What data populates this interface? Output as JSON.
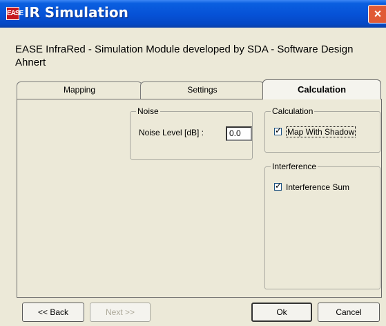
{
  "window": {
    "icon_text": "EASE",
    "title": "IR Simulation",
    "close_glyph": "×"
  },
  "description": "EASE InfraRed - Simulation Module developed by SDA - Software Design Ahnert",
  "tabs": [
    {
      "label": "Mapping",
      "selected": false
    },
    {
      "label": "Settings",
      "selected": false
    },
    {
      "label": "Calculation",
      "selected": true
    }
  ],
  "noise": {
    "legend": "Noise",
    "level_label": "Noise Level [dB] :",
    "level_value": "0.0"
  },
  "calculation": {
    "legend": "Calculation",
    "map_with_shadow_label": "Map With Shadow",
    "map_with_shadow_checked": true
  },
  "interference": {
    "legend": "Interference",
    "interference_sum_label": "Interference Sum",
    "interference_sum_checked": true
  },
  "buttons": {
    "back": "<< Back",
    "next": "Next >>",
    "ok": "Ok",
    "cancel": "Cancel"
  },
  "check_glyph": "✓"
}
